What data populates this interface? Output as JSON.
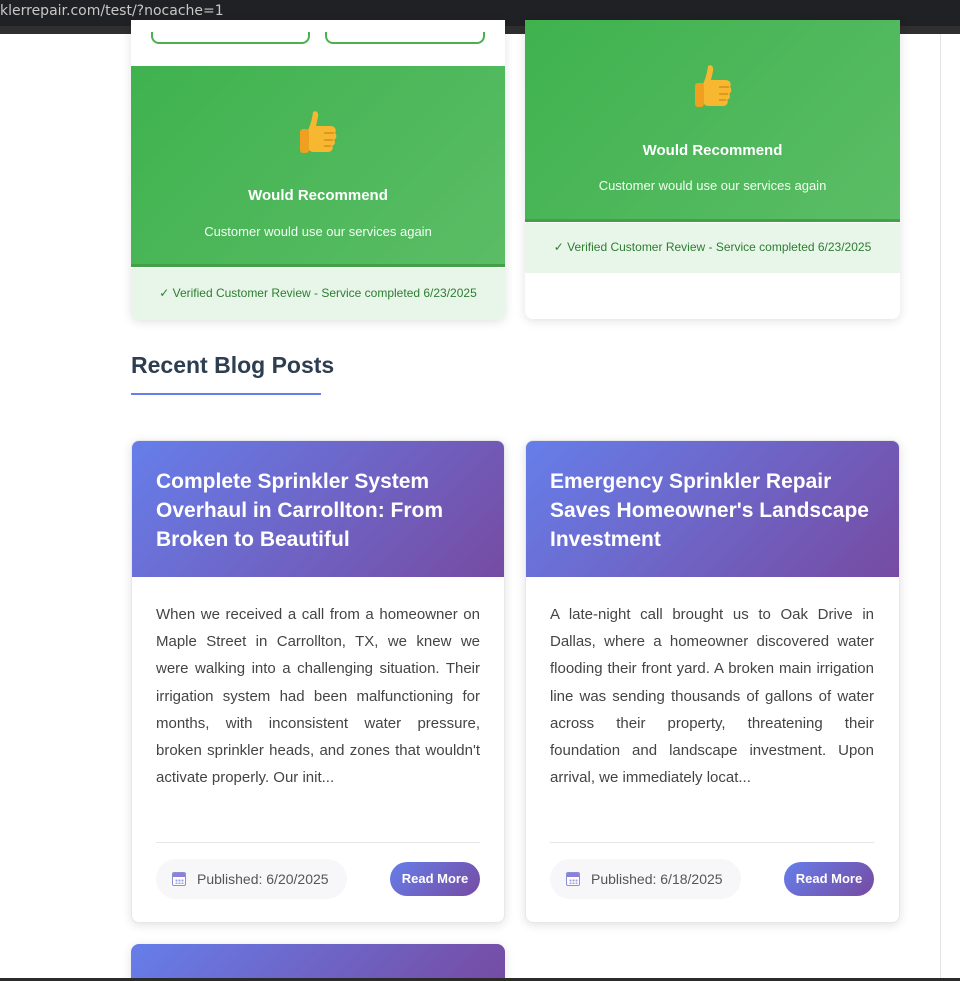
{
  "browser": {
    "url": "klerrepair.com/test/?nocache=1"
  },
  "reviews": [
    {
      "icon": "thumbs-up-icon",
      "title": "Would Recommend",
      "subtitle": "Customer would use our services again",
      "verified": "✓ Verified Customer Review - Service completed 6/23/2025"
    },
    {
      "icon": "thumbs-up-icon",
      "title": "Would Recommend",
      "subtitle": "Customer would use our services again",
      "verified": "✓ Verified Customer Review - Service completed 6/23/2025"
    }
  ],
  "blog": {
    "section_title": "Recent Blog Posts",
    "posts": [
      {
        "title": "Complete Sprinkler System Overhaul in Carrollton: From Broken to Beautiful",
        "excerpt": "When we received a call from a homeowner on Maple Street in Carrollton, TX, we knew we were walking into a challenging situation. Their irrigation system had been malfunctioning for months, with inconsistent water pressure, broken sprinkler heads, and zones that wouldn't activate properly. Our init...",
        "published": "Published: 6/20/2025",
        "read_more": "Read More"
      },
      {
        "title": "Emergency Sprinkler Repair Saves Homeowner's Landscape Investment",
        "excerpt": "A late-night call brought us to Oak Drive in Dallas, where a homeowner discovered water flooding their front yard. A broken main irrigation line was sending thousands of gallons of water across their property, threatening their foundation and landscape investment. Upon arrival, we immediately locat...",
        "published": "Published: 6/18/2025",
        "read_more": "Read More"
      }
    ]
  }
}
